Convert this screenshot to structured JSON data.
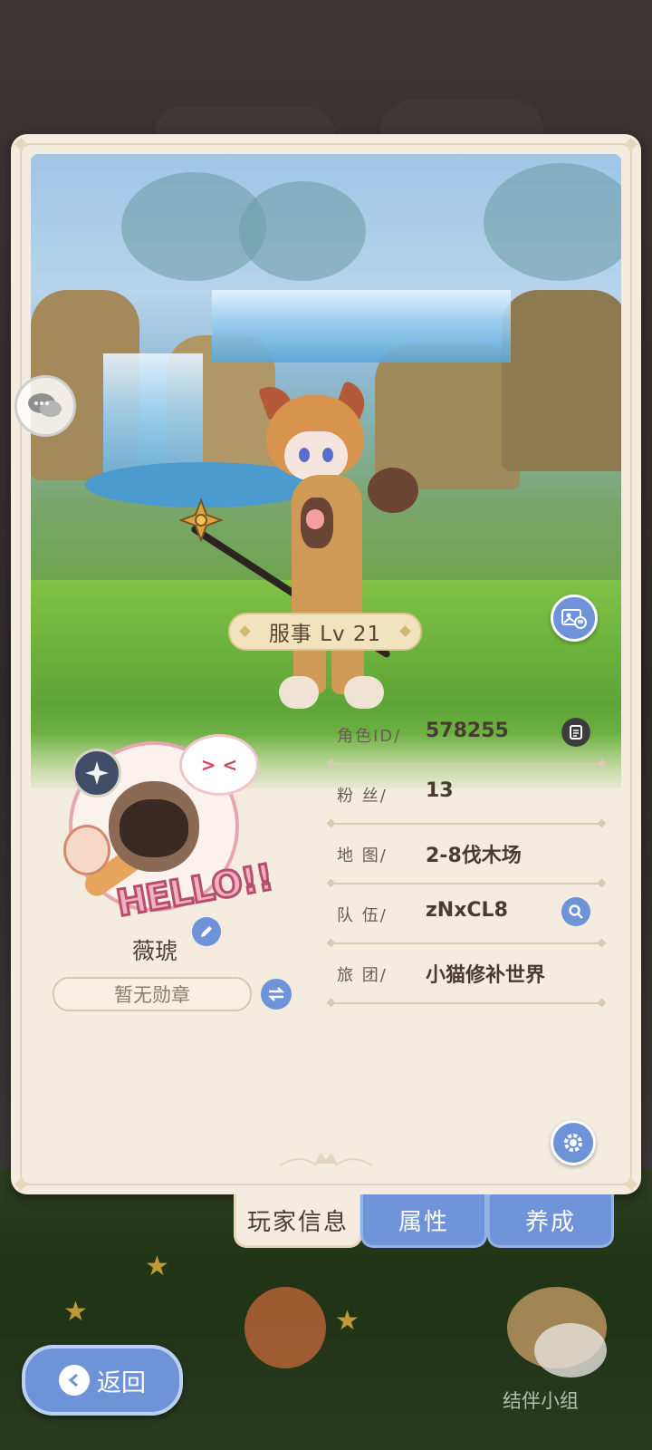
{
  "scene": {
    "level_label": "服事 Lv  21"
  },
  "profile": {
    "avatar_text": "HELLO!!",
    "name": "薇琥",
    "medal": "暂无勋章"
  },
  "info": [
    {
      "label": "角色ID/",
      "value": "578255",
      "action": "copy-icon"
    },
    {
      "label": "粉  丝/",
      "value": "13"
    },
    {
      "label": "地  图/",
      "value": "2-8伐木场"
    },
    {
      "label": "队  伍/",
      "value": "zNxCL8",
      "action": "search-icon"
    },
    {
      "label": "旅  团/",
      "value": "小猫修补世界"
    }
  ],
  "tabs": [
    {
      "label": "玩家信息",
      "active": true
    },
    {
      "label": "属性",
      "active": false
    },
    {
      "label": "养成",
      "active": false
    }
  ],
  "bottom": {
    "back_label": "返回",
    "group_label": "结伴小组"
  },
  "colors": {
    "accent_blue": "#6e93d8",
    "card_bg": "#f3ecdf",
    "text_dark": "#4a3b31"
  }
}
